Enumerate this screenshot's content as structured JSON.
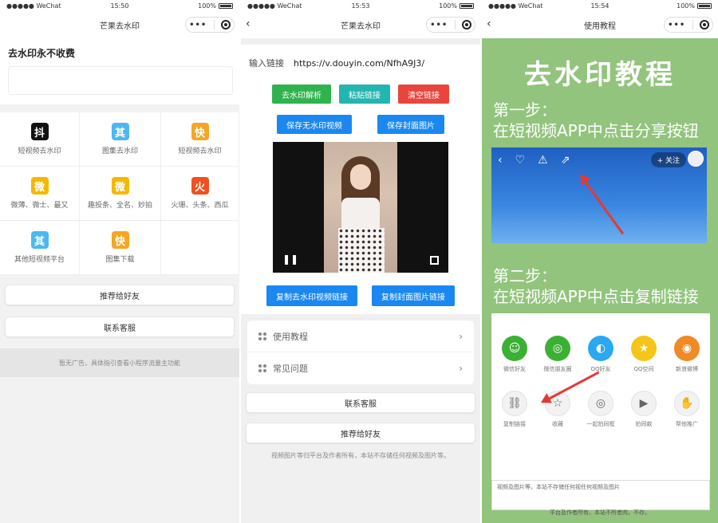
{
  "status": {
    "carrier": "●●●●● WeChat",
    "battery": "100%",
    "time1": "15:50",
    "time2": "15:53",
    "time3": "15:54"
  },
  "phone1": {
    "nav_title": "芒果去水印",
    "heading": "去水印永不收费",
    "grid": [
      {
        "glyph": "抖",
        "label": "短视频去水印",
        "color": "#111111"
      },
      {
        "glyph": "其",
        "label": "图集去水印",
        "color": "#4db8f0"
      },
      {
        "glyph": "快",
        "label": "短视频去水印",
        "color": "#f5a623"
      },
      {
        "glyph": "微",
        "label": "微薄、微士、最又",
        "color": "#f5b800"
      },
      {
        "glyph": "微",
        "label": "趣投条、全名、妙拍",
        "color": "#f5b800"
      },
      {
        "glyph": "火",
        "label": "火珊、头条、西瓜",
        "color": "#f05022"
      },
      {
        "glyph": "其",
        "label": "其他短视频平台",
        "color": "#4db8f0"
      },
      {
        "glyph": "快",
        "label": "图集下载",
        "color": "#f5a623"
      },
      {
        "glyph": "",
        "label": "",
        "color": "#ffffff"
      }
    ],
    "recommend": "推荐给好友",
    "contact": "联系客服",
    "ad": "暂无广告，具体指引查看小程序流量主功能"
  },
  "phone2": {
    "nav_title": "芒果去水印",
    "link_label": "输入链接",
    "link_value": "https://v.douyin.com/NfhA9J3/",
    "btn_parse": "去水印解析",
    "btn_paste": "粘贴链接",
    "btn_clear": "清空链接",
    "btn_save_video": "保存无水印视频",
    "btn_save_cover": "保存封面图片",
    "btn_copy_video": "复制去水印视频链接",
    "btn_copy_cover": "复制封面图片链接",
    "menu_tutorial": "使用教程",
    "menu_faq": "常见问题",
    "contact": "联系客服",
    "recommend": "推荐给好友",
    "footer": "视频图片等归平台及作者所有，本站不存储任何视频及图片等。"
  },
  "phone3": {
    "nav_title": "使用教程",
    "title": "去水印教程",
    "step1_head": "第一步：",
    "step1_text": "在短视频APP中点击分享按钮",
    "follow": "+ 关注",
    "step2_head": "第二步：",
    "step2_text": "在短视频APP中点击复制链接",
    "share_row1": [
      "微信好友",
      "微信朋友圈",
      "QQ好友",
      "QQ空间",
      "新浪微博"
    ],
    "share_row2": [
      "复制链接",
      "收藏",
      "一起拍同框",
      "拍同款",
      "帮他推广"
    ],
    "bottom_text": "视频及图片等，本站不存储任何视任何视频及图片",
    "footer": "平台及作者所有，本站不所者肉，不存。"
  }
}
